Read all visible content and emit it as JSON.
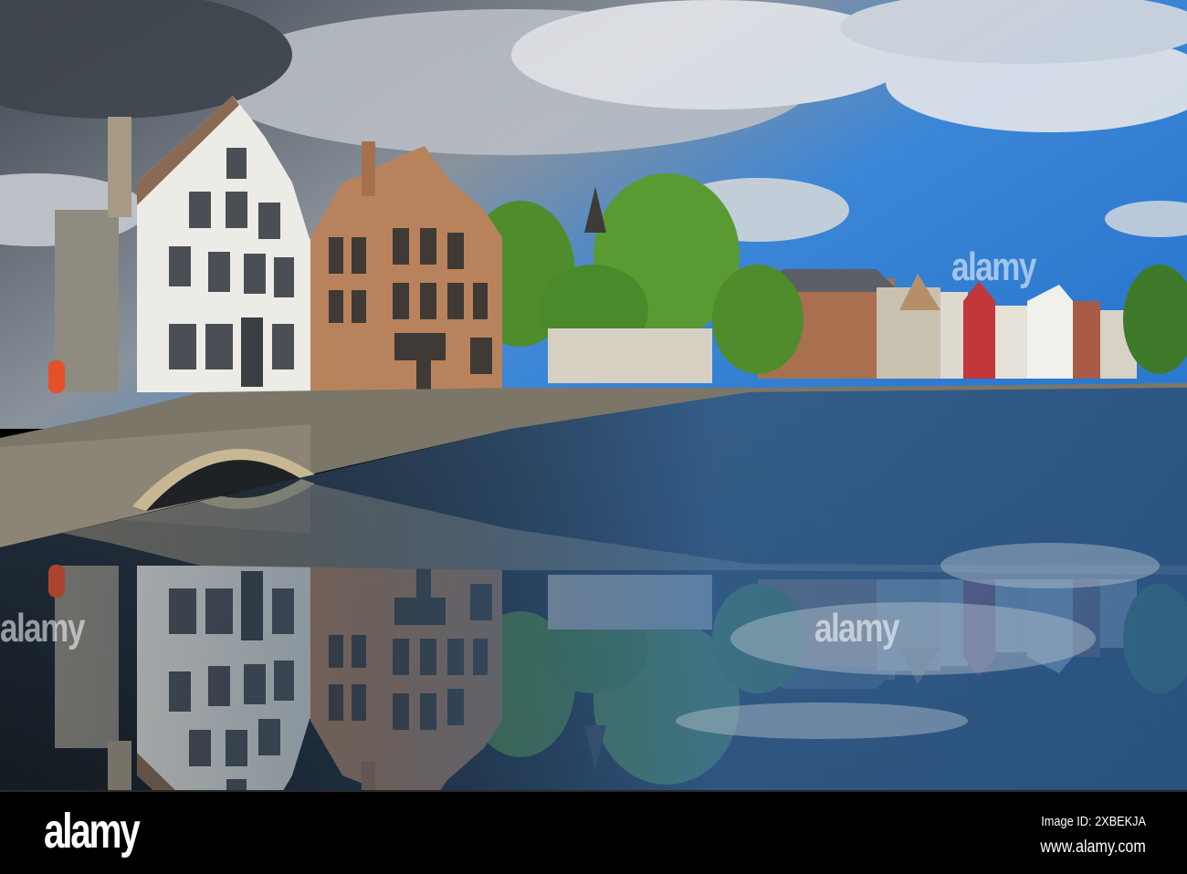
{
  "photo": {
    "subject": "canal-with-gabled-houses",
    "colors": {
      "sky": "#2f7fd0",
      "cloud": "#e6e8ec",
      "storm": "#4a5058",
      "brick": "#b8835c",
      "white_house": "#ecebe6",
      "tree": "#4f8c2c",
      "water": "#1d2a36"
    }
  },
  "watermarks": [
    "alamy",
    "alamy",
    "alamy"
  ],
  "footer": {
    "logo": "alamy",
    "image_id": "Image ID: 2XBEKJA",
    "website": "www.alamy.com"
  }
}
